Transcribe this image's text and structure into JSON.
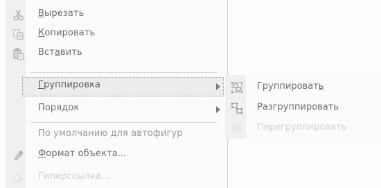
{
  "context_menu": {
    "items": [
      {
        "pre": "",
        "ul": "В",
        "post": "ырезать",
        "icon": "scissors-icon"
      },
      {
        "pre": "",
        "ul": "К",
        "post": "опировать",
        "icon": "copy-icon"
      },
      {
        "pre": "Вст",
        "ul": "а",
        "post": "вить",
        "icon": "paste-icon"
      },
      {
        "pre": "",
        "ul": "Г",
        "post": "руппировка",
        "icon": ""
      },
      {
        "pre": "Поря",
        "ul": "д",
        "post": "ок",
        "icon": ""
      },
      {
        "pre": "По умолчанию для автофигур",
        "ul": "",
        "post": "",
        "icon": ""
      },
      {
        "pre": "",
        "ul": "Ф",
        "post": "ормат объекта...",
        "icon": "format-object-icon"
      },
      {
        "pre": "Гиперссылка...",
        "ul": "",
        "post": "",
        "icon": "hyperlink-icon"
      }
    ]
  },
  "submenu": {
    "items": [
      {
        "pre": "Группироват",
        "ul": "ь",
        "post": "",
        "icon": "group-icon"
      },
      {
        "pre": "Разгруппировать",
        "ul": "",
        "post": "",
        "icon": "ungroup-icon"
      },
      {
        "pre": "Перегруппировать",
        "ul": "",
        "post": "",
        "icon": "regroup-icon"
      }
    ]
  },
  "colors": {
    "text": "#6d6d6d",
    "disabled": "#d4d4d4",
    "gutter": "#f0f0f0",
    "highlight": "#ececec"
  }
}
